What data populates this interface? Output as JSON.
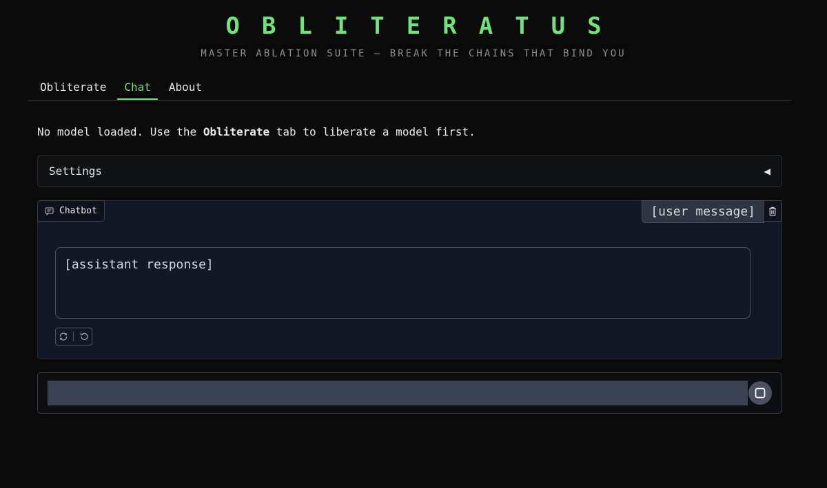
{
  "header": {
    "title": "OBLITERATUS",
    "subtitle": "MASTER ABLATION SUITE — BREAK THE CHAINS THAT BIND YOU"
  },
  "tabs": [
    {
      "label": "Obliterate"
    },
    {
      "label": "Chat"
    },
    {
      "label": "About"
    }
  ],
  "status": {
    "prefix": "No model loaded. Use the ",
    "bold": "Obliterate",
    "suffix": " tab to liberate a model first."
  },
  "settings": {
    "label": "Settings",
    "toggle": "◀"
  },
  "chatbot": {
    "label": "Chatbot",
    "user_message": "[user message]",
    "bot_message": {
      "line1": "[assistant response]",
      "line2_bold": "",
      "line2": ""
    }
  },
  "input": {
    "placeholder": "",
    "value": ""
  },
  "colors": {
    "accent": "#6ee47a",
    "background": "#0b0b0b",
    "chat_bg": "#131826",
    "input_bg": "#3b4252"
  }
}
